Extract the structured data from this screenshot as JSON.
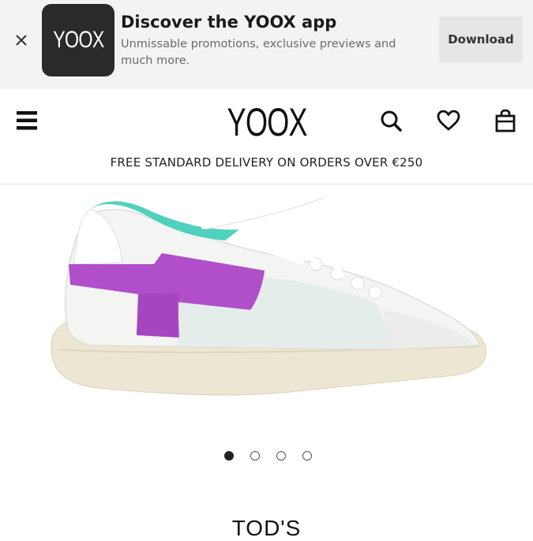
{
  "app_banner": {
    "close_icon": "close-icon",
    "logo_text": "YOOX",
    "title": "Discover the YOOX app",
    "description": "Unmissable promotions, exclusive previews and much more.",
    "download_label": "Download"
  },
  "header": {
    "menu_icon": "hamburger-menu-icon",
    "logo": "YOOX",
    "search_icon": "search-icon",
    "wishlist_icon": "heart-icon",
    "bag_icon": "shopping-bag-icon",
    "promo": "FREE STANDARD DELIVERY ON ORDERS OVER €250"
  },
  "product": {
    "image_icon": "sneaker-image",
    "carousel": {
      "total": 4,
      "active": 1
    },
    "brand": "TOD'S"
  },
  "colors": {
    "accent_purple": "#b04fc9",
    "accent_teal": "#4fd1bd",
    "sole": "#ede6d2",
    "banner_bg": "#f3f3f3"
  }
}
